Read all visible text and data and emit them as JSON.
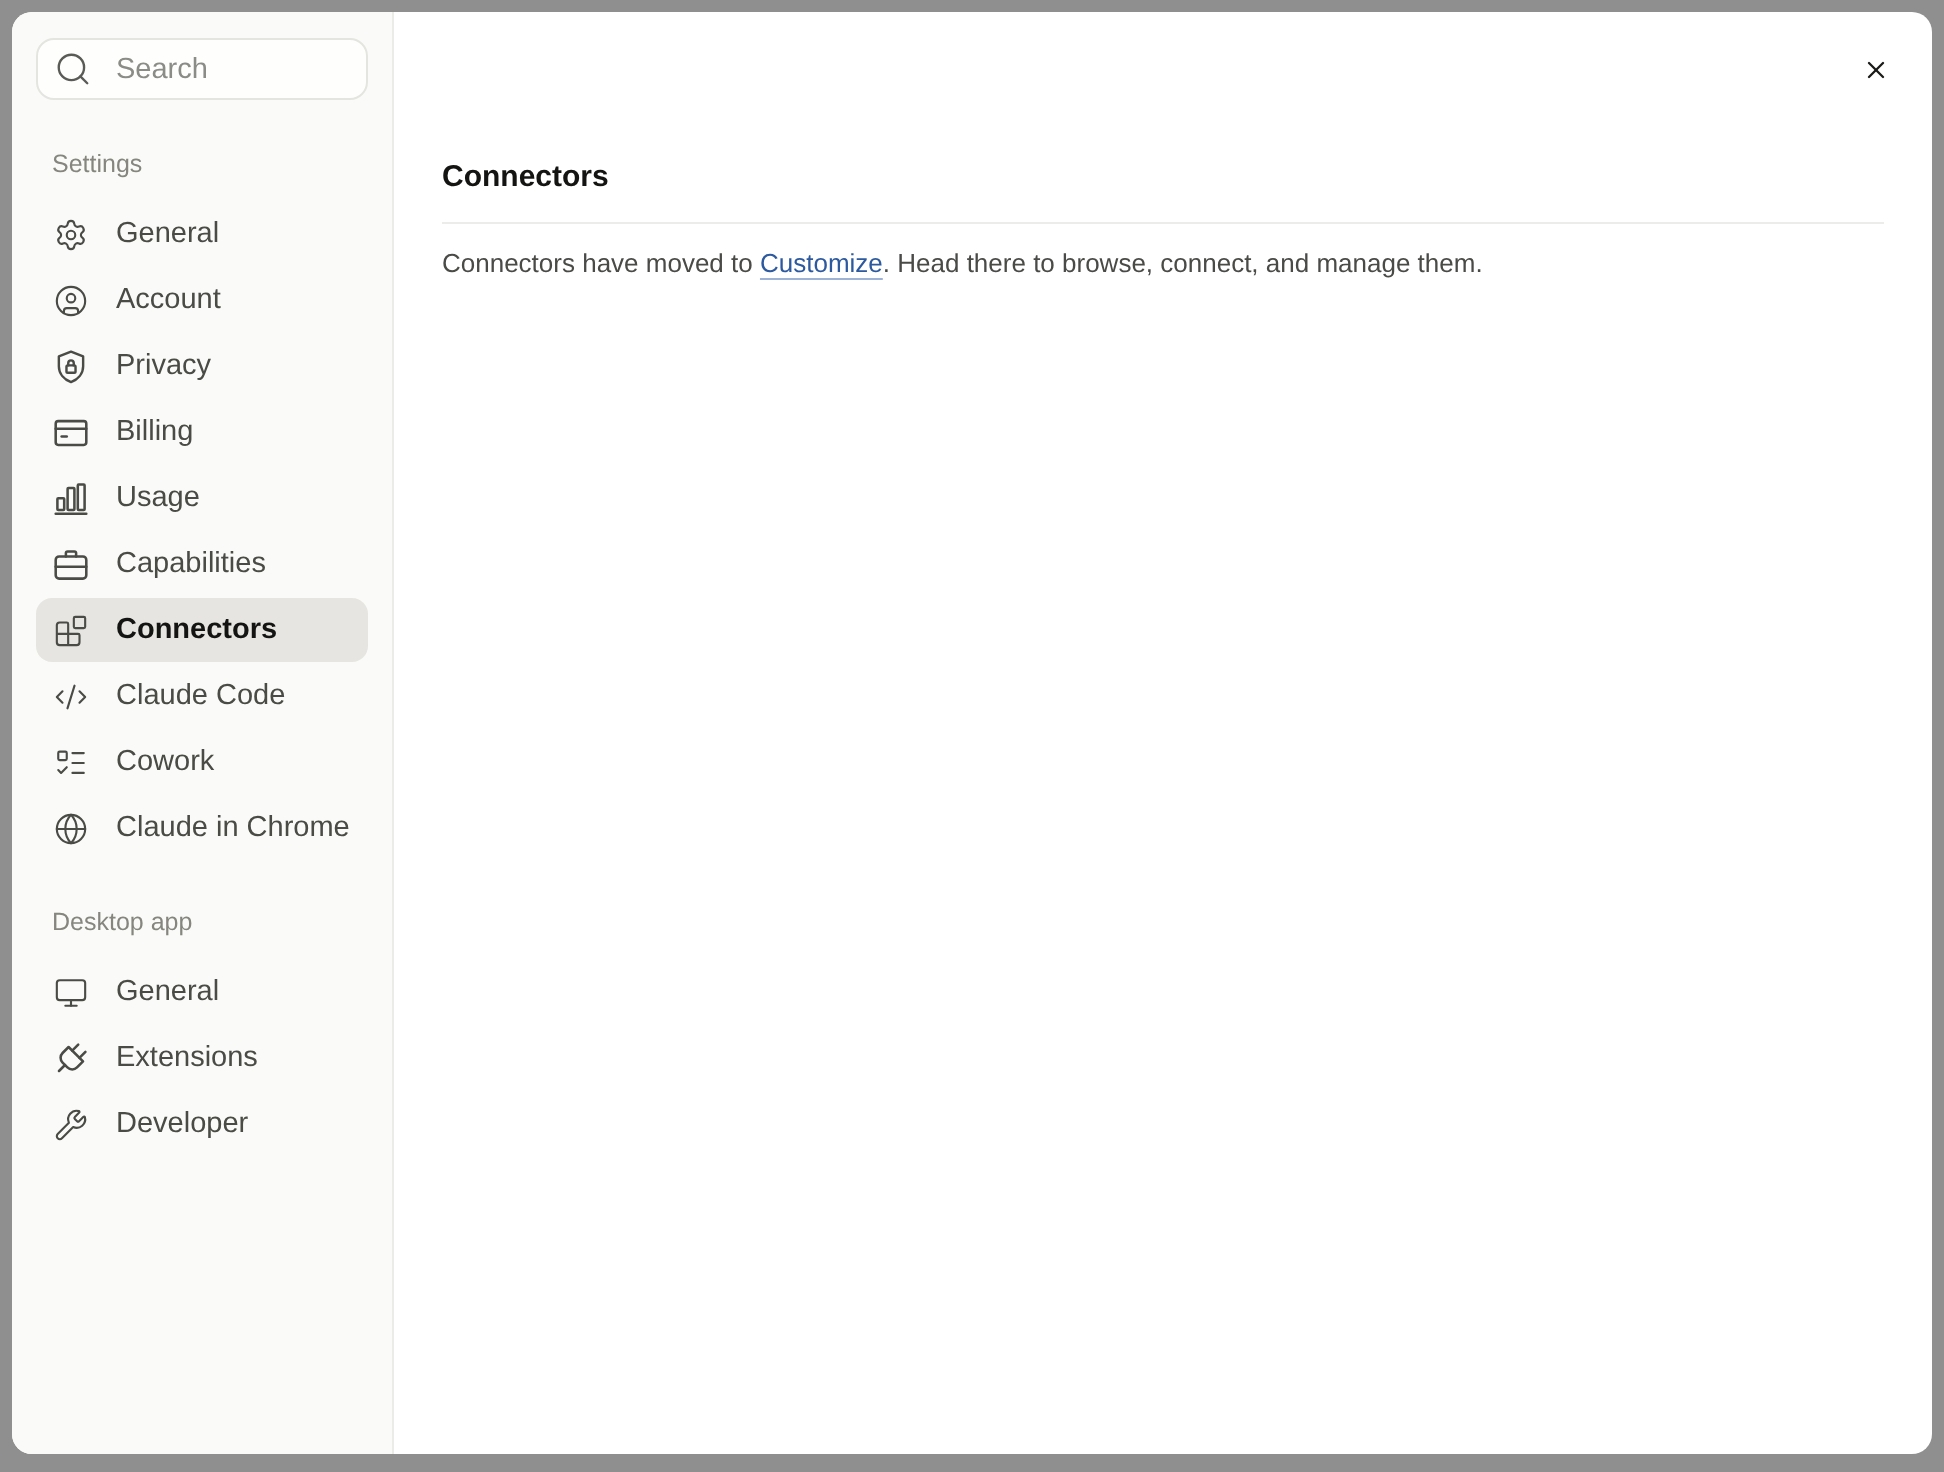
{
  "sidebar": {
    "search": {
      "placeholder": "Search"
    },
    "sections": [
      {
        "title": "Settings",
        "items": [
          {
            "label": "General",
            "selected": false
          },
          {
            "label": "Account",
            "selected": false
          },
          {
            "label": "Privacy",
            "selected": false
          },
          {
            "label": "Billing",
            "selected": false
          },
          {
            "label": "Usage",
            "selected": false
          },
          {
            "label": "Capabilities",
            "selected": false
          },
          {
            "label": "Connectors",
            "selected": true
          },
          {
            "label": "Claude Code",
            "selected": false
          },
          {
            "label": "Cowork",
            "selected": false
          },
          {
            "label": "Claude in Chrome",
            "selected": false
          }
        ]
      },
      {
        "title": "Desktop app",
        "items": [
          {
            "label": "General",
            "selected": false
          },
          {
            "label": "Extensions",
            "selected": false
          },
          {
            "label": "Developer",
            "selected": false
          }
        ]
      }
    ]
  },
  "content": {
    "title": "Connectors",
    "message": {
      "text_before": "Connectors have moved to ",
      "link": "Customize",
      "text_after": ". Head there to browse, connect, and manage them."
    }
  }
}
